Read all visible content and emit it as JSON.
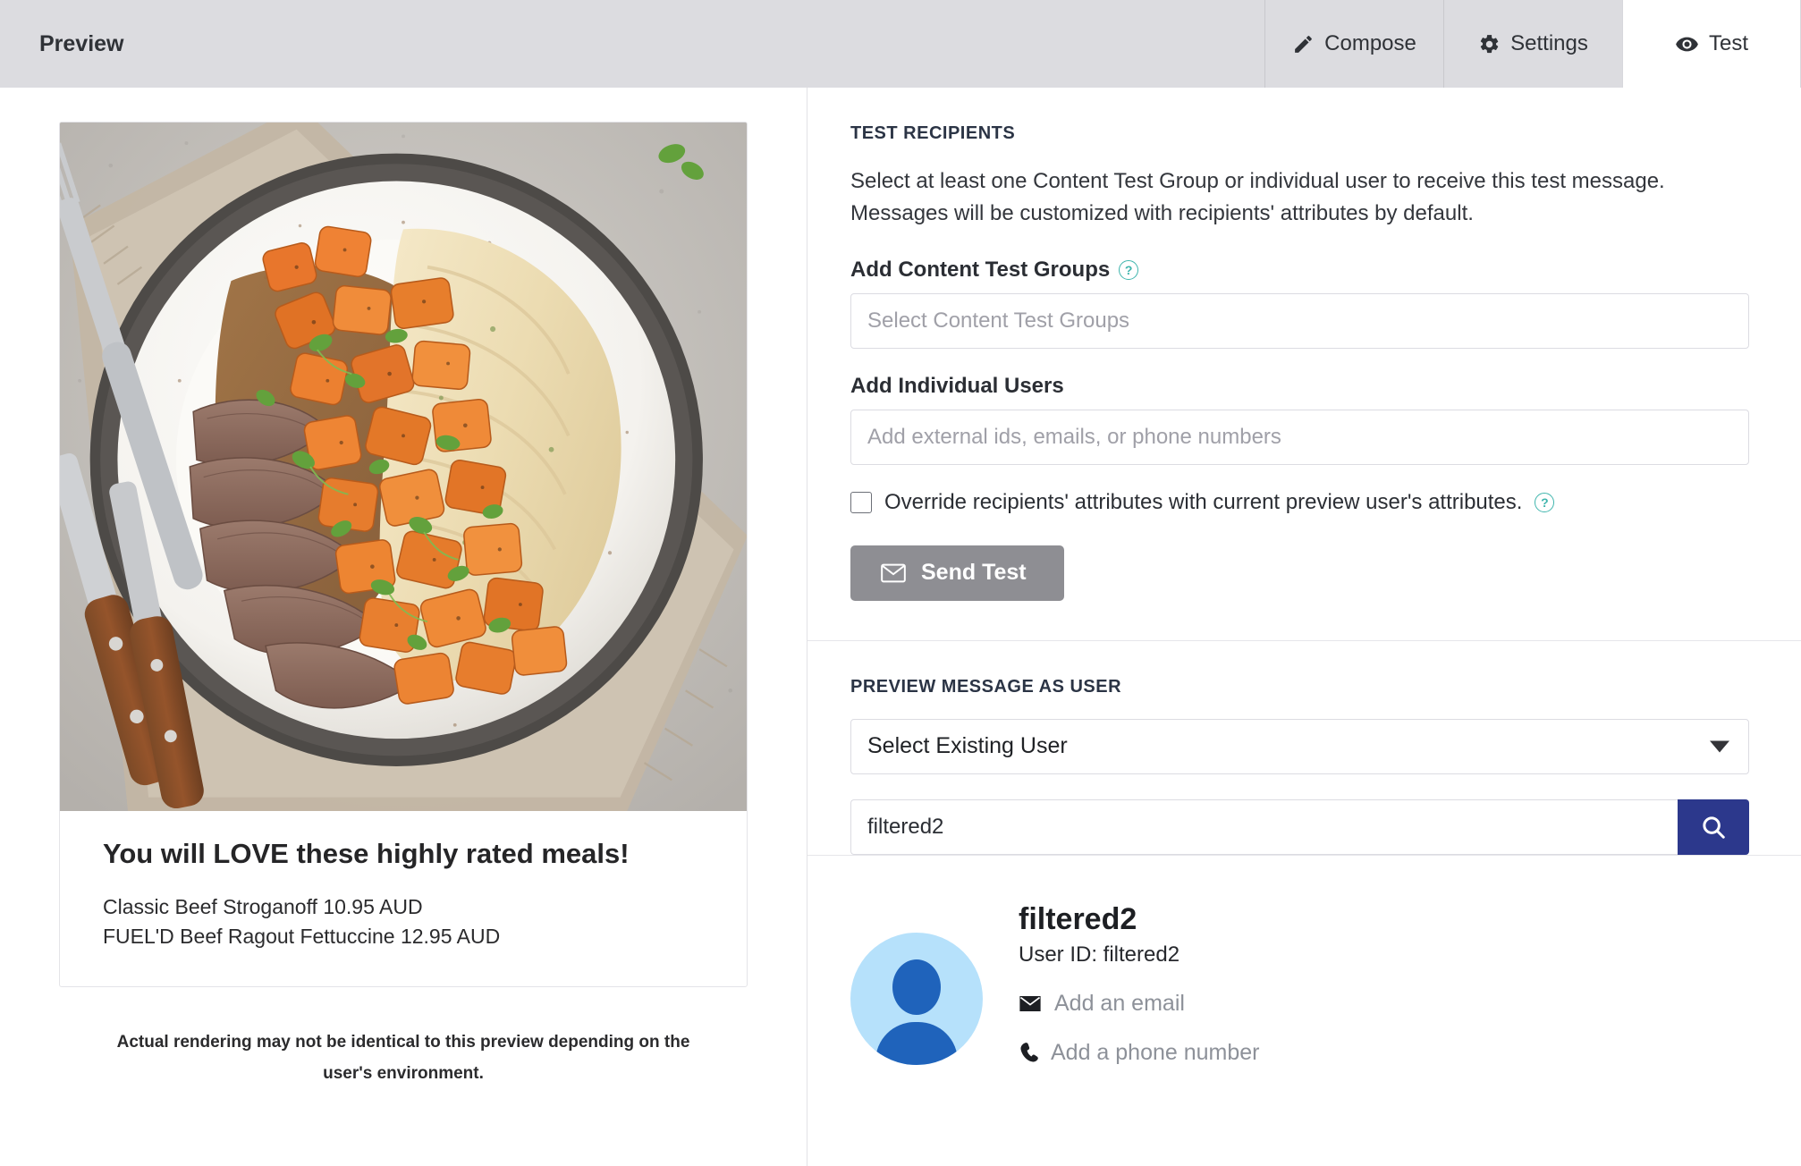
{
  "header": {
    "title": "Preview",
    "tabs": [
      {
        "label": "Compose",
        "icon": "pencil-icon",
        "active": false
      },
      {
        "label": "Settings",
        "icon": "gear-icon",
        "active": false
      },
      {
        "label": "Test",
        "icon": "eye-icon",
        "active": true
      }
    ]
  },
  "preview": {
    "card": {
      "heading": "You will LOVE these highly rated meals!",
      "lines": [
        "Classic Beef Stroganoff  10.95 AUD",
        "FUEL'D Beef Ragout Fettuccine  12.95 AUD"
      ],
      "image_alt": "plated sliced beef with gravy, roasted sweet potato and mashed potato"
    },
    "disclaimer": "Actual rendering may not be identical to this preview depending on the user's environment."
  },
  "test_recipients": {
    "section_title": "TEST RECIPIENTS",
    "description": "Select at least one Content Test Group or individual user to receive this test message. Messages will be customized with recipients' attributes by default.",
    "content_groups": {
      "label": "Add Content Test Groups",
      "help": "?",
      "value": "",
      "placeholder": "Select Content Test Groups"
    },
    "individual_users": {
      "label": "Add Individual Users",
      "value": "",
      "placeholder": "Add external ids, emails, or phone numbers"
    },
    "override": {
      "label": "Override recipients' attributes with current preview user's attributes.",
      "help": "?",
      "checked": false
    },
    "send_button": {
      "label": "Send Test",
      "icon": "envelope-icon",
      "disabled": true,
      "color": "#8e8e93"
    }
  },
  "preview_as_user": {
    "section_title": "PREVIEW MESSAGE AS USER",
    "select": {
      "value": "Select Existing User",
      "caret_icon": "chevron-down-icon"
    },
    "search": {
      "value": "filtered2",
      "placeholder": "",
      "button_icon": "search-icon",
      "button_color": "#2c388c"
    },
    "result": {
      "name": "filtered2",
      "user_id_label": "User ID: filtered2",
      "links": [
        {
          "label": "Add an email",
          "icon": "envelope-icon"
        },
        {
          "label": "Add a phone number",
          "icon": "phone-icon"
        }
      ],
      "avatar_icon": "person-avatar-icon"
    }
  },
  "colors": {
    "header_bg": "#dcdce0",
    "accent_blue": "#2c388c",
    "help_teal": "#3fb5ad",
    "avatar_bg": "#b6e1fb",
    "avatar_fg": "#1f63bb",
    "disabled_gray": "#8e8e93"
  }
}
